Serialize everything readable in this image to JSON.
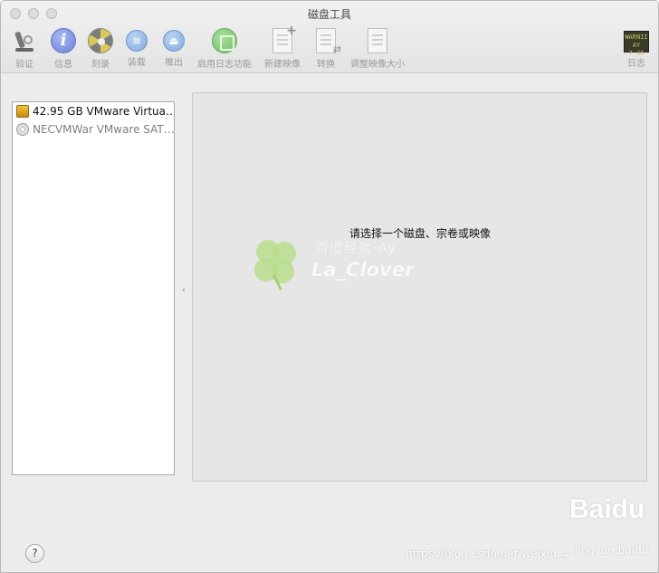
{
  "window": {
    "title": "磁盘工具"
  },
  "toolbar": {
    "items": [
      {
        "label": "验证",
        "icon": "verify-icon"
      },
      {
        "label": "信息",
        "icon": "info-icon",
        "glyph": "i"
      },
      {
        "label": "刻录",
        "icon": "burn-icon"
      },
      {
        "label": "装载",
        "icon": "mount-icon",
        "glyph": "≡"
      },
      {
        "label": "推出",
        "icon": "eject-icon",
        "glyph": "⏏"
      },
      {
        "label": "启用日志功能",
        "icon": "enable-journaling-icon"
      },
      {
        "label": "新建映像",
        "icon": "new-image-icon",
        "glyph": "+"
      },
      {
        "label": "转换",
        "icon": "convert-icon",
        "glyph": "⇄"
      },
      {
        "label": "调整映像大小",
        "icon": "resize-image-icon"
      },
      {
        "label": "日志",
        "icon": "log-icon",
        "glyph_top": "WARNII",
        "glyph_bottom": "AY 7:36"
      }
    ]
  },
  "sidebar": {
    "items": [
      {
        "label": "42.95 GB VMware Virtua…",
        "icon": "hard-disk-icon"
      },
      {
        "label": "NECVMWar VMware SAT…",
        "icon": "cd-drive-icon"
      }
    ]
  },
  "main": {
    "prompt": "请选择一个磁盘、宗卷或映像"
  },
  "footer": {
    "help_glyph": "?"
  },
  "watermarks": {
    "experience_line1": "百度经验·Ay",
    "experience_line2": "La_Clover",
    "baidu": "Baidu",
    "baidu_sub": "jingyan.baidu",
    "csdn": "https://blog.csdn.net/weixin_4"
  },
  "colors": {
    "info_blue": "#6a7fd8",
    "enable_green": "#6fbf63",
    "disk_orange": "#f2c23e",
    "panel_gray": "#e6e6e6"
  }
}
